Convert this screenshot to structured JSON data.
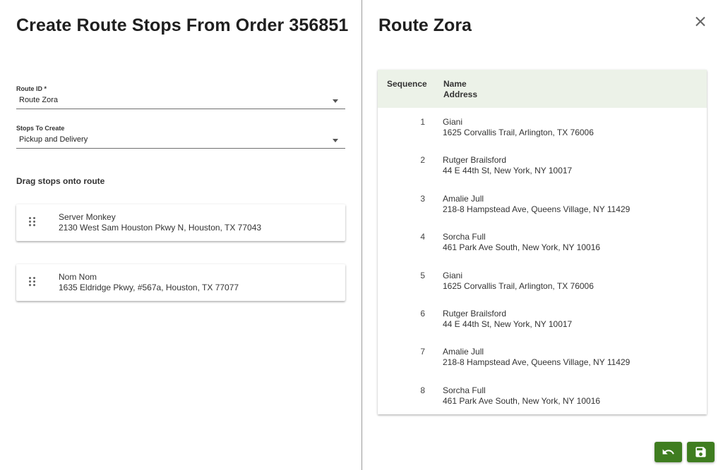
{
  "left": {
    "title": "Create Route Stops From Order 356851",
    "route_field": {
      "label": "Route ID *",
      "value": "Route Zora"
    },
    "stops_field": {
      "label": "Stops To Create",
      "value": "Pickup and Delivery"
    },
    "drag_heading": "Drag stops onto route",
    "stops": [
      {
        "name": "Server Monkey",
        "address": "2130 West Sam Houston Pkwy N, Houston, TX 77043"
      },
      {
        "name": "Nom Nom",
        "address": "1635 Eldridge Pkwy, #567a, Houston, TX 77077"
      }
    ]
  },
  "right": {
    "title": "Route Zora",
    "table": {
      "headers": {
        "sequence": "Sequence",
        "name": "Name",
        "address": "Address"
      },
      "rows": [
        {
          "seq": "1",
          "name": "Giani",
          "address": "1625 Corvallis Trail, Arlington, TX 76006"
        },
        {
          "seq": "2",
          "name": "Rutger Brailsford",
          "address": "44 E 44th St, New York, NY 10017"
        },
        {
          "seq": "3",
          "name": "Amalie Jull",
          "address": "218-8 Hampstead Ave, Queens Village, NY 11429"
        },
        {
          "seq": "4",
          "name": "Sorcha Full",
          "address": "461 Park Ave South, New York, NY 10016"
        },
        {
          "seq": "5",
          "name": "Giani",
          "address": "1625 Corvallis Trail, Arlington, TX 76006"
        },
        {
          "seq": "6",
          "name": "Rutger Brailsford",
          "address": "44 E 44th St, New York, NY 10017"
        },
        {
          "seq": "7",
          "name": "Amalie Jull",
          "address": "218-8 Hampstead Ave, Queens Village, NY 11429"
        },
        {
          "seq": "8",
          "name": "Sorcha Full",
          "address": "461 Park Ave South, New York, NY 10016"
        }
      ]
    },
    "buttons": {
      "undo_icon": "undo-icon",
      "save_icon": "floppy-disk-icon"
    }
  },
  "colors": {
    "accent": "#3f7d20",
    "table_header_bg": "#ecf2e8",
    "divider": "#9a9a9a"
  }
}
